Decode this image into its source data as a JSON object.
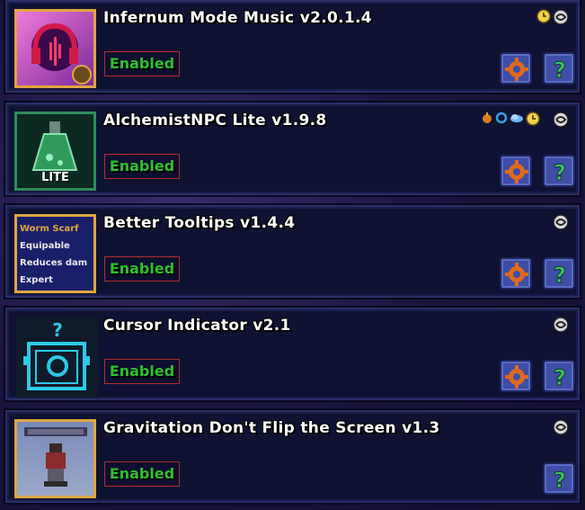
{
  "mods": [
    {
      "title": "Infernum Mode Music v2.0.1.4",
      "status": "Enabled",
      "side_icons": [
        "clock-icon",
        "swirl-icon"
      ],
      "has_config": true,
      "has_help": true
    },
    {
      "title": "AlchemistNPC Lite v1.9.8",
      "status": "Enabled",
      "thumb_label": "LITE",
      "side_icons": [
        "orange-bomb-icon",
        "blue-ring-icon",
        "cloud-icon",
        "clock-icon",
        "swirl-icon"
      ],
      "has_config": true,
      "has_help": true
    },
    {
      "title": "Better Tooltips v1.4.4",
      "status": "Enabled",
      "thumb_lines": [
        "Worm Scarf",
        "Equipable",
        "Reduces dam",
        "Expert"
      ],
      "side_icons": [
        "swirl-icon"
      ],
      "has_config": true,
      "has_help": true
    },
    {
      "title": "Cursor Indicator v2.1",
      "status": "Enabled",
      "side_icons": [
        "swirl-icon"
      ],
      "has_config": true,
      "has_help": true
    },
    {
      "title": "Gravitation Don't Flip the Screen v1.3",
      "status": "Enabled",
      "side_icons": [
        "swirl-icon"
      ],
      "has_config": false,
      "has_help": true
    }
  ],
  "colors": {
    "card_bg": "#0f1233",
    "enabled_text": "#2fbf2f",
    "enabled_border": "#b32c2c",
    "button_bg": "#3e4ea6",
    "gear": "#e0691a",
    "help": "#41c36e"
  }
}
